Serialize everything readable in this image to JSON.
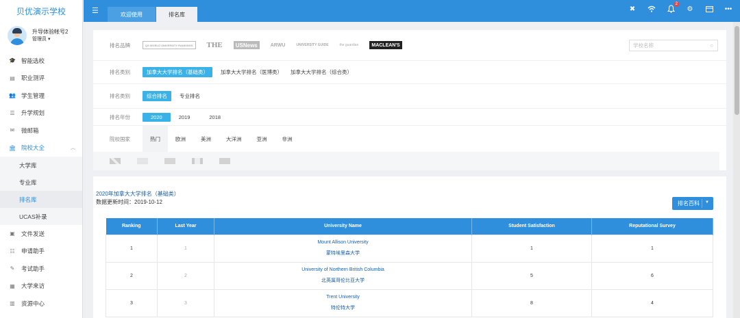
{
  "app": {
    "school_name": "贝优演示学校"
  },
  "user": {
    "name": "升导体验帐号2",
    "role": "管理员 ▾"
  },
  "menu": [
    {
      "label": "智能选校",
      "icon": "graduation-cap-icon",
      "glyph": "🎓"
    },
    {
      "label": "职业测评",
      "icon": "assessment-icon",
      "glyph": "▤"
    },
    {
      "label": "学生管理",
      "icon": "users-icon",
      "glyph": "👥"
    },
    {
      "label": "升学规划",
      "icon": "planning-icon",
      "glyph": "☰"
    },
    {
      "label": "微邮箱",
      "icon": "mail-icon",
      "glyph": "✉"
    },
    {
      "label": "院校大全",
      "icon": "institution-icon",
      "glyph": "🏛"
    },
    {
      "label": "文件发送",
      "icon": "file-send-icon",
      "glyph": "▣"
    },
    {
      "label": "申请助手",
      "icon": "list-icon",
      "glyph": "☷"
    },
    {
      "label": "考试助手",
      "icon": "edit-icon",
      "glyph": "✎"
    },
    {
      "label": "大学来访",
      "icon": "calendar-icon",
      "glyph": "▦"
    },
    {
      "label": "资源中心",
      "icon": "resource-icon",
      "glyph": "▥"
    }
  ],
  "submenu": [
    "大学库",
    "专业库",
    "排名库",
    "UCAS补录"
  ],
  "topbar": {
    "tabs": [
      "欢迎使用",
      "排名库"
    ],
    "notification_count": "2"
  },
  "filters": {
    "brand_label": "排名品牌",
    "brands": [
      "QS WORLD UNIVERSITY RANKINGS",
      "THE",
      "USNews",
      "ARWU",
      "UNIVERSITY GUIDE",
      "the guardian",
      "MACLEAN'S"
    ],
    "search_placeholder": "学校名称",
    "category_label": "排名类别",
    "categories": [
      "加拿大大学排名（基础类）",
      "加拿大大学排名（医博类）",
      "加拿大大学排名（综合类）"
    ],
    "type_label": "排名类别",
    "types": [
      "综合排名",
      "专业排名"
    ],
    "year_label": "排名年份",
    "years": [
      "2020",
      "2019",
      "2018"
    ],
    "country_label": "院校国家",
    "regions": [
      "热门",
      "欧洲",
      "美洲",
      "大洋洲",
      "亚洲",
      "非洲"
    ]
  },
  "ranking": {
    "title": "2020年加拿大大学排名（基础类）",
    "update_text": "数据更新时间：2019-10-12",
    "button_label": "排名百科",
    "columns": [
      "Ranking",
      "Last Year",
      "University Name",
      "Student Satisfaction",
      "Reputational Survey"
    ],
    "rows": [
      {
        "rank": "1",
        "last": "1",
        "name_en": "Mount Allison University",
        "name_zh": "蒙特埃里森大学",
        "satisfaction": "1",
        "reputation": "1"
      },
      {
        "rank": "2",
        "last": "2",
        "name_en": "University of Northern British Columbia",
        "name_zh": "北英属哥伦比亚大学",
        "satisfaction": "5",
        "reputation": "6"
      },
      {
        "rank": "3",
        "last": "3",
        "name_en": "Trent University",
        "name_zh": "特伦特大学",
        "satisfaction": "8",
        "reputation": "4"
      }
    ]
  }
}
